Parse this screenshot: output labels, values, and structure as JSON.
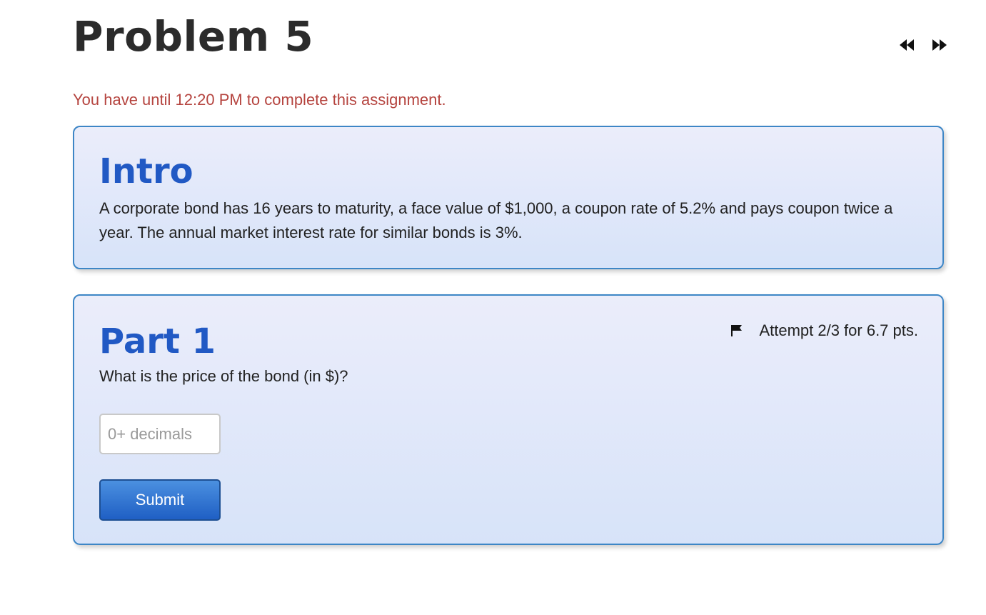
{
  "page": {
    "title": "Problem 5",
    "nav": {
      "prev_icon": "rewind-icon",
      "next_icon": "fast-forward-icon"
    },
    "deadline": "You have until 12:20 PM to complete this assignment."
  },
  "intro": {
    "heading": "Intro",
    "text": "A corporate bond has 16 years to maturity, a face value of $1,000, a coupon rate of 5.2% and pays coupon twice a year. The annual market interest rate for similar bonds is 3%."
  },
  "part1": {
    "heading": "Part 1",
    "flag_icon": "flag-icon",
    "attempt": "Attempt 2/3 for 6.7 pts.",
    "question": "What is the price of the bond (in $)?",
    "input": {
      "value": "",
      "placeholder": "0+ decimals"
    },
    "submit_label": "Submit"
  },
  "colors": {
    "title": "#2b2b2b",
    "deadline": "#b5443f",
    "heading": "#2159c4",
    "card_border": "#3d86c6",
    "submit_bg": "#1f5fc4"
  }
}
